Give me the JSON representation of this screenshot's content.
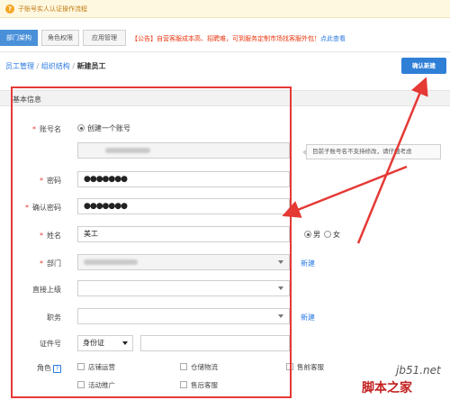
{
  "top_notice": {
    "help_glyph": "?",
    "text": "子账号实人认证操作流程"
  },
  "tabs": [
    {
      "label": "部门架构",
      "active": true
    },
    {
      "label": "角色权限",
      "active": false
    },
    {
      "label": "应用管理",
      "active": false
    }
  ],
  "announcement": {
    "text": "【公告】自营客服成本高、招聘难，可到服务定制市场找客服外包！",
    "link": "点此查看"
  },
  "breadcrumb": {
    "item1": "员工管理",
    "sep": " / ",
    "item2": "组织结构",
    "current": "新建员工"
  },
  "confirm_button": "确认新建",
  "section_title": "基本信息",
  "form": {
    "account": {
      "label": "账号名",
      "radio_label": "创建一个账号",
      "tip": "目前子账号名不支持修改，请仔细考虑"
    },
    "password": {
      "label": "密码",
      "value": "●●●●●●●"
    },
    "confirm_password": {
      "label": "确认密码",
      "value": "●●●●●●●"
    },
    "name": {
      "label": "姓名",
      "value": "美工",
      "gender_male": "男",
      "gender_female": "女"
    },
    "department": {
      "label": "部门",
      "new_link": "新建"
    },
    "supervisor": {
      "label": "直接上级"
    },
    "position": {
      "label": "职务",
      "new_link": "新建"
    },
    "id_number": {
      "label": "证件号",
      "type": "身份证"
    },
    "roles": {
      "label": "角色",
      "help_glyph": "?",
      "options": [
        "店铺运营",
        "仓储物流",
        "售前客服",
        "活动推广",
        "售后客服"
      ]
    }
  },
  "watermark": {
    "line1": "jb51.net",
    "line2": "脚本之家"
  },
  "colors": {
    "accent": "#2f7fd6",
    "highlight_box": "#e53935",
    "required": "#e53935"
  }
}
